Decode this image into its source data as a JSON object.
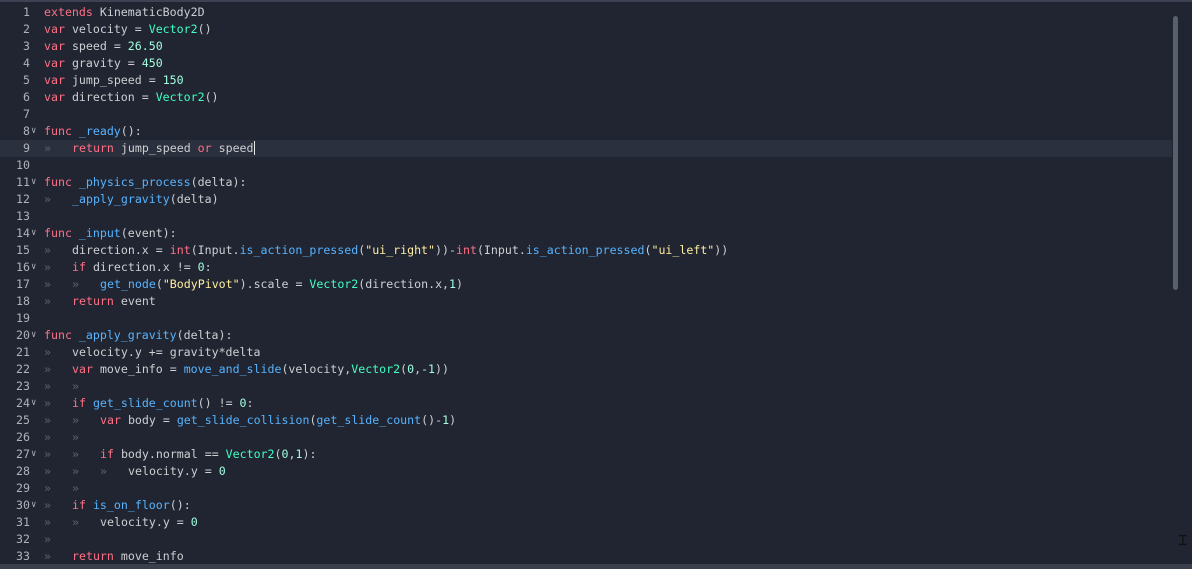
{
  "editor": {
    "lines": [
      {
        "n": "1",
        "code": [
          [
            "kw",
            "extends"
          ],
          [
            "",
            "KinematicBody2D"
          ]
        ]
      },
      {
        "n": "2",
        "code": [
          [
            "kw",
            "var"
          ],
          [
            "",
            "velocity = "
          ],
          [
            "bi",
            "Vector2"
          ],
          [
            "",
            "()"
          ]
        ]
      },
      {
        "n": "3",
        "code": [
          [
            "kw",
            "var"
          ],
          [
            "",
            "speed = "
          ],
          [
            "num",
            "26.50"
          ]
        ]
      },
      {
        "n": "4",
        "code": [
          [
            "kw",
            "var"
          ],
          [
            "",
            "gravity = "
          ],
          [
            "num",
            "450"
          ]
        ]
      },
      {
        "n": "5",
        "code": [
          [
            "kw",
            "var"
          ],
          [
            "",
            "jump_speed = "
          ],
          [
            "num",
            "150"
          ]
        ]
      },
      {
        "n": "6",
        "code": [
          [
            "kw",
            "var"
          ],
          [
            "",
            "direction = "
          ],
          [
            "bi",
            "Vector2"
          ],
          [
            "",
            "()"
          ]
        ]
      },
      {
        "n": "7",
        "code": []
      },
      {
        "n": "8",
        "fold": true,
        "code": [
          [
            "kw",
            "func"
          ],
          [
            "",
            ""
          ],
          [
            "fn",
            "_ready"
          ],
          [
            "",
            "():"
          ]
        ]
      },
      {
        "n": "9",
        "current": true,
        "caret": true,
        "tabs": 1,
        "code": [
          [
            "kw",
            "return"
          ],
          [
            "",
            "jump_speed "
          ],
          [
            "kw",
            "or"
          ],
          [
            "",
            "speed"
          ]
        ]
      },
      {
        "n": "10",
        "code": []
      },
      {
        "n": "11",
        "fold": true,
        "code": [
          [
            "kw",
            "func"
          ],
          [
            "",
            ""
          ],
          [
            "fn",
            "_physics_process"
          ],
          [
            "",
            "(delta):"
          ]
        ]
      },
      {
        "n": "12",
        "tabs": 1,
        "code": [
          [
            "fn",
            "_apply_gravity"
          ],
          [
            "",
            "(delta)"
          ]
        ]
      },
      {
        "n": "13",
        "code": []
      },
      {
        "n": "14",
        "fold": true,
        "code": [
          [
            "kw",
            "func"
          ],
          [
            "",
            ""
          ],
          [
            "fn",
            "_input"
          ],
          [
            "",
            "(event):"
          ]
        ]
      },
      {
        "n": "15",
        "tabs": 1,
        "code": [
          [
            "",
            "direction.x = "
          ],
          [
            "kw",
            "int"
          ],
          [
            "",
            "(Input."
          ],
          [
            "fn",
            "is_action_pressed"
          ],
          [
            "",
            "("
          ],
          [
            "str",
            "\"ui_right\""
          ],
          [
            "",
            "))-"
          ],
          [
            "kw",
            "int"
          ],
          [
            "",
            "(Input."
          ],
          [
            "fn",
            "is_action_pressed"
          ],
          [
            "",
            "("
          ],
          [
            "str",
            "\"ui_left\""
          ],
          [
            "",
            "))"
          ]
        ]
      },
      {
        "n": "16",
        "fold": true,
        "tabs": 1,
        "code": [
          [
            "kw",
            "if"
          ],
          [
            "",
            "direction.x != "
          ],
          [
            "num",
            "0"
          ],
          [
            "",
            ":"
          ]
        ]
      },
      {
        "n": "17",
        "tabs": 2,
        "code": [
          [
            "fn",
            "get_node"
          ],
          [
            "",
            "("
          ],
          [
            "str",
            "\"BodyPivot\""
          ],
          [
            "",
            ").scale = "
          ],
          [
            "bi",
            "Vector2"
          ],
          [
            "",
            "(direction.x,"
          ],
          [
            "num",
            "1"
          ],
          [
            "",
            ")"
          ]
        ]
      },
      {
        "n": "18",
        "tabs": 1,
        "code": [
          [
            "kw",
            "return"
          ],
          [
            "",
            "event"
          ]
        ]
      },
      {
        "n": "19",
        "code": []
      },
      {
        "n": "20",
        "fold": true,
        "code": [
          [
            "kw",
            "func"
          ],
          [
            "",
            ""
          ],
          [
            "fn",
            "_apply_gravity"
          ],
          [
            "",
            "(delta):"
          ]
        ]
      },
      {
        "n": "21",
        "tabs": 1,
        "code": [
          [
            "",
            "velocity.y += gravity*delta"
          ]
        ]
      },
      {
        "n": "22",
        "tabs": 1,
        "code": [
          [
            "kw",
            "var"
          ],
          [
            "",
            "move_info = "
          ],
          [
            "fn",
            "move_and_slide"
          ],
          [
            "",
            "(velocity,"
          ],
          [
            "bi",
            "Vector2"
          ],
          [
            "",
            "("
          ],
          [
            "num",
            "0"
          ],
          [
            "",
            ","
          ],
          [
            "num",
            "-1"
          ],
          [
            "",
            "))"
          ]
        ]
      },
      {
        "n": "23",
        "tabs": 2,
        "code": []
      },
      {
        "n": "24",
        "fold": true,
        "tabs": 1,
        "code": [
          [
            "kw",
            "if"
          ],
          [
            "fn",
            "get_slide_count"
          ],
          [
            "",
            "() != "
          ],
          [
            "num",
            "0"
          ],
          [
            "",
            ":"
          ]
        ]
      },
      {
        "n": "25",
        "tabs": 2,
        "code": [
          [
            "kw",
            "var"
          ],
          [
            "",
            "body = "
          ],
          [
            "fn",
            "get_slide_collision"
          ],
          [
            "",
            "("
          ],
          [
            "fn",
            "get_slide_count"
          ],
          [
            "",
            "()-"
          ],
          [
            "num",
            "1"
          ],
          [
            "",
            ")"
          ]
        ]
      },
      {
        "n": "26",
        "tabs": 2,
        "code": []
      },
      {
        "n": "27",
        "fold": true,
        "tabs": 2,
        "code": [
          [
            "kw",
            "if"
          ],
          [
            "",
            "body.normal == "
          ],
          [
            "bi",
            "Vector2"
          ],
          [
            "",
            "("
          ],
          [
            "num",
            "0"
          ],
          [
            "",
            ","
          ],
          [
            "num",
            "1"
          ],
          [
            "",
            "):"
          ]
        ]
      },
      {
        "n": "28",
        "tabs": 3,
        "code": [
          [
            "",
            "velocity.y = "
          ],
          [
            "num",
            "0"
          ]
        ]
      },
      {
        "n": "29",
        "tabs": 2,
        "code": []
      },
      {
        "n": "30",
        "fold": true,
        "tabs": 1,
        "code": [
          [
            "kw",
            "if"
          ],
          [
            "fn",
            "is_on_floor"
          ],
          [
            "",
            "():"
          ]
        ]
      },
      {
        "n": "31",
        "tabs": 2,
        "code": [
          [
            "",
            "velocity.y = "
          ],
          [
            "num",
            "0"
          ]
        ]
      },
      {
        "n": "32",
        "tabs": 1,
        "code": []
      },
      {
        "n": "33",
        "tabs": 1,
        "code": [
          [
            "kw",
            "return"
          ],
          [
            "",
            "move_info"
          ]
        ]
      }
    ]
  }
}
